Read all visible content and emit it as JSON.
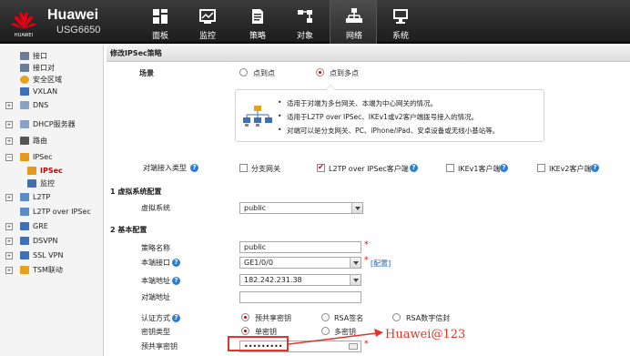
{
  "brand": {
    "name": "Huawei",
    "model": "USG6650",
    "logo_text": "HUAWEI"
  },
  "topnav": [
    {
      "label": "面板",
      "icon": "dashboard-icon"
    },
    {
      "label": "监控",
      "icon": "monitor-icon"
    },
    {
      "label": "策略",
      "icon": "policy-icon"
    },
    {
      "label": "对象",
      "icon": "object-icon"
    },
    {
      "label": "网络",
      "icon": "network-icon",
      "active": true
    },
    {
      "label": "系统",
      "icon": "system-icon"
    }
  ],
  "sidebar": {
    "items": [
      {
        "label": "接口",
        "icon": "interface-icon"
      },
      {
        "label": "接口对",
        "icon": "interface-pair-icon"
      },
      {
        "label": "安全区域",
        "icon": "security-zone-icon"
      },
      {
        "label": "VXLAN",
        "icon": "vxlan-icon"
      },
      {
        "label": "DNS",
        "icon": "dns-icon"
      },
      {
        "label": "DHCP服务器",
        "icon": "dhcp-icon"
      },
      {
        "label": "路由",
        "icon": "route-icon"
      },
      {
        "label": "IPSec",
        "icon": "ipsec-icon"
      },
      {
        "label": "IPSec",
        "icon": "ipsec-sub-icon",
        "selected": true
      },
      {
        "label": "监控",
        "icon": "monitor-sub-icon"
      },
      {
        "label": "L2TP",
        "icon": "l2tp-icon"
      },
      {
        "label": "L2TP over IPSec",
        "icon": "l2tp-ipsec-icon"
      },
      {
        "label": "GRE",
        "icon": "gre-icon"
      },
      {
        "label": "DSVPN",
        "icon": "dsvpn-icon"
      },
      {
        "label": "SSL VPN",
        "icon": "sslvpn-icon"
      },
      {
        "label": "TSM联动",
        "icon": "tsm-icon"
      }
    ]
  },
  "main": {
    "title": "修改IPSec策略",
    "scene": {
      "label": "场景",
      "options": [
        "点到点",
        "点到多点"
      ],
      "selected": "点到多点"
    },
    "info_lines": [
      "适用于对端为多台网关、本端为中心网关的情况。",
      "适用于L2TP over IPSec、IKEv1或v2客户端拨号接入的情况。",
      "对端可以是分支网关、PC、iPhone/iPad、安卓设备或无线小基站等。"
    ],
    "peer_type": {
      "label": "对端接入类型",
      "options": [
        {
          "label": "分支网关",
          "checked": false
        },
        {
          "label": "L2TP over IPSec客户端",
          "checked": true
        },
        {
          "label": "IKEv1客户端",
          "checked": false
        },
        {
          "label": "IKEv2客户端",
          "checked": false
        }
      ]
    },
    "section1": {
      "number": "1",
      "title": "虚拟系统配置"
    },
    "vsys": {
      "label": "虚拟系统",
      "value": "public"
    },
    "section2": {
      "number": "2",
      "title": "基本配置"
    },
    "policy_name": {
      "label": "策略名称",
      "value": "public"
    },
    "local_if": {
      "label": "本端接口",
      "value": "GE1/0/0",
      "link": "[配置]"
    },
    "local_addr": {
      "label": "本端地址",
      "value": "182.242.231.38"
    },
    "peer_addr": {
      "label": "对端地址",
      "value": ""
    },
    "auth": {
      "label": "认证方式",
      "options": [
        "预共享密钥",
        "RSA签名",
        "RSA数字信封"
      ],
      "selected": "预共享密钥"
    },
    "key_type": {
      "label": "密钥类型",
      "options": [
        "单密钥",
        "多密钥"
      ],
      "selected": "单密钥"
    },
    "psk": {
      "label": "预共享密钥",
      "value": "•••••••••",
      "annotation": "Huawei@123"
    }
  },
  "colors": {
    "accent": "#cc0000",
    "annotation": "#e2352a",
    "link": "#1d5fb4",
    "topbar": "#2a2a2a"
  }
}
